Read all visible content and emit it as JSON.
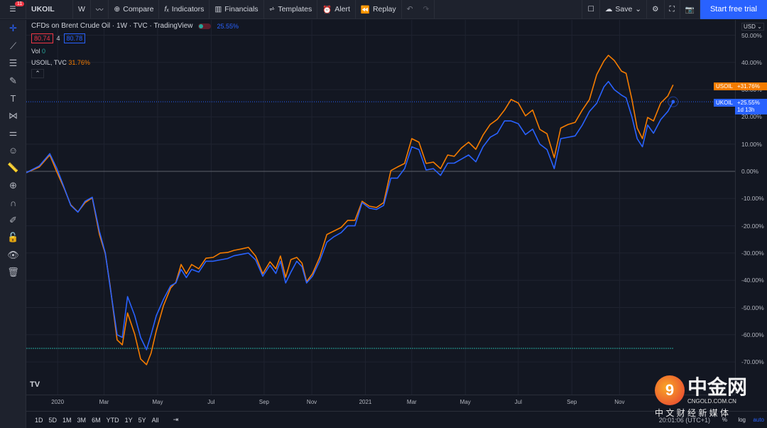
{
  "topbar": {
    "menu_badge": "11",
    "symbol": "UKOIL",
    "interval": "W",
    "compare": "Compare",
    "indicators": "Indicators",
    "financials": "Financials",
    "templates": "Templates",
    "alert": "Alert",
    "replay": "Replay",
    "save": "Save",
    "trial": "Start free trial"
  },
  "legend": {
    "title": "CFDs on Brent Crude Oil · 1W · TVC · TradingView",
    "change": "25.55%",
    "bid": "80.74",
    "spread": "4",
    "ask": "80.78",
    "vol_label": "Vol",
    "vol_value": "0",
    "compare_label": "USOIL, TVC",
    "compare_value": "31.76%"
  },
  "price_axis": {
    "currency": "USD",
    "usoil_label": "USOIL",
    "usoil_value": "+31.76%",
    "ukoil_label": "UKOIL",
    "ukoil_value": "+25.55%",
    "countdown": "1d 13h"
  },
  "bottom": {
    "ranges": [
      "1D",
      "5D",
      "1M",
      "3M",
      "6M",
      "YTD",
      "1Y",
      "5Y",
      "All"
    ],
    "time": "20:01:06 (UTC+1)",
    "percent": "%",
    "log": "log",
    "auto": "auto"
  },
  "watermark": {
    "name": "中金网",
    "domain": "CNGOLD.COM.CN",
    "slogan": "中 文 财 经 新 媒 体"
  },
  "colors": {
    "ukoil": "#2962ff",
    "usoil": "#f57c00",
    "accent": "#2962ff"
  },
  "chart_data": {
    "type": "line",
    "ylabel": "%",
    "ylim": [
      -75,
      55
    ],
    "xlim": [
      0,
      108
    ],
    "yticks": [
      "50.00%",
      "40.00%",
      "30.00%",
      "20.00%",
      "10.00%",
      "0.00%",
      "-10.00%",
      "-20.00%",
      "-30.00%",
      "-40.00%",
      "-50.00%",
      "-60.00%",
      "-70.00%"
    ],
    "ytick_values": [
      50,
      40,
      30,
      20,
      10,
      0,
      -10,
      -20,
      -30,
      -40,
      -50,
      -60,
      -70
    ],
    "xticks": [
      {
        "label": "2020",
        "w": 4.8
      },
      {
        "label": "Mar",
        "w": 11.9
      },
      {
        "label": "May",
        "w": 20.1
      },
      {
        "label": "Jul",
        "w": 28.3
      },
      {
        "label": "Sep",
        "w": 36.4
      },
      {
        "label": "Nov",
        "w": 43.7
      },
      {
        "label": "2021",
        "w": 51.9
      },
      {
        "label": "Mar",
        "w": 59.0
      },
      {
        "label": "May",
        "w": 67.2
      },
      {
        "label": "Jul",
        "w": 75.3
      },
      {
        "label": "Sep",
        "w": 83.5
      },
      {
        "label": "Nov",
        "w": 90.8
      }
    ],
    "x_weeks": [
      0,
      2.0,
      3.6,
      4.7,
      5.8,
      6.8,
      7.9,
      9.0,
      10.1,
      11.2,
      12.1,
      12.8,
      13.9,
      14.7,
      15.5,
      16.6,
      17.5,
      18.4,
      19.1,
      19.9,
      21.0,
      22.1,
      22.9,
      23.7,
      24.5,
      25.3,
      26.4,
      27.5,
      28.6,
      29.7,
      30.8,
      31.8,
      32.9,
      34.0,
      35.1,
      36.2,
      37.3,
      38.2,
      38.9,
      39.7,
      40.5,
      41.4,
      42.2,
      42.9,
      43.8,
      44.9,
      46.0,
      47.1,
      48.2,
      49.2,
      50.3,
      51.4,
      52.5,
      53.6,
      54.7,
      55.8,
      56.8,
      57.9,
      59.0,
      60.1,
      61.2,
      62.3,
      63.4,
      64.5,
      65.5,
      66.6,
      67.7,
      68.8,
      69.9,
      71.0,
      72.1,
      73.2,
      74.2,
      75.3,
      76.4,
      77.5,
      78.6,
      79.7,
      80.8,
      81.8,
      82.9,
      84.0,
      85.1,
      86.2,
      87.3,
      88.4,
      89.1,
      90.0,
      91.1,
      91.8,
      92.7,
      93.5,
      94.3,
      95.1,
      96.0,
      97.1,
      98.2,
      99.0
    ],
    "series": [
      {
        "name": "USOIL",
        "values": [
          -0.5,
          1.6,
          6.0,
          -0.3,
          -6.3,
          -12.3,
          -14.9,
          -11.5,
          -9.7,
          -23.2,
          -30.3,
          -41.5,
          -61.9,
          -63.7,
          -52.0,
          -59.8,
          -68.9,
          -71.0,
          -66.8,
          -58.5,
          -49.3,
          -42.8,
          -40.7,
          -34.2,
          -37.6,
          -34.2,
          -35.8,
          -31.9,
          -31.6,
          -30.0,
          -29.8,
          -29.0,
          -28.5,
          -27.9,
          -31.1,
          -37.6,
          -33.2,
          -35.8,
          -31.1,
          -38.9,
          -32.4,
          -31.6,
          -33.7,
          -40.5,
          -37.6,
          -31.6,
          -23.2,
          -21.9,
          -20.6,
          -18.0,
          -18.0,
          -11.0,
          -12.8,
          -13.3,
          -11.5,
          0.3,
          1.6,
          2.9,
          12.0,
          10.7,
          2.9,
          3.4,
          1.0,
          6.0,
          5.5,
          8.6,
          10.7,
          8.1,
          13.3,
          17.2,
          19.1,
          22.5,
          26.4,
          25.1,
          20.4,
          22.5,
          15.4,
          13.8,
          5.0,
          15.9,
          17.2,
          18.0,
          22.5,
          26.4,
          35.5,
          40.5,
          42.6,
          40.7,
          36.8,
          36.0,
          26.4,
          15.9,
          12.0,
          19.8,
          18.5,
          25.1,
          27.7,
          31.76
        ]
      },
      {
        "name": "UKOIL",
        "values": [
          -0.5,
          2.0,
          6.5,
          1,
          -6,
          -12.5,
          -15,
          -11,
          -9.5,
          -22,
          -30,
          -42,
          -60,
          -61,
          -46,
          -53,
          -61,
          -65.5,
          -60,
          -53,
          -47,
          -42,
          -41,
          -36,
          -39,
          -36,
          -37,
          -33,
          -33,
          -32.5,
          -32,
          -31,
          -30.5,
          -30,
          -32.5,
          -38.5,
          -34.5,
          -37.5,
          -33,
          -41,
          -37,
          -33,
          -35,
          -41,
          -38.5,
          -33,
          -26,
          -24,
          -22.5,
          -20,
          -20,
          -11.5,
          -13.5,
          -14,
          -12.5,
          -2.5,
          -2.5,
          1,
          9,
          8,
          0.5,
          1,
          -1.5,
          3,
          3,
          4.5,
          6,
          3.5,
          9,
          12.5,
          14,
          18.5,
          18.5,
          17.5,
          13.5,
          15.5,
          10,
          8,
          1,
          12,
          12.5,
          13,
          17,
          22,
          25,
          31,
          33,
          30,
          28,
          27,
          20,
          12,
          9,
          17,
          14,
          19,
          22,
          25.55
        ]
      }
    ]
  }
}
